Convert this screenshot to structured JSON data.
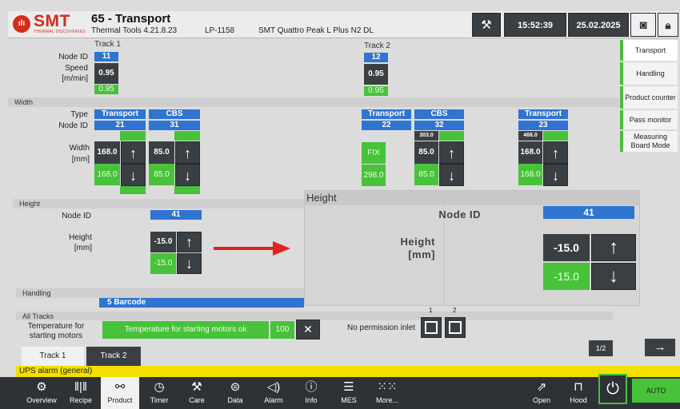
{
  "header": {
    "title": "65 - Transport",
    "version": "Thermal Tools 4.21.8.23",
    "machine_id": "LP-1158",
    "machine_name": "SMT Quattro Peak L Plus N2 DL",
    "time": "15:52:39",
    "date": "25.02.2025",
    "logo": {
      "text": "SMT",
      "subtitle": "THERMAL DISCOVERIES"
    }
  },
  "right_menu": [
    {
      "label": "Transport"
    },
    {
      "label": "Handling"
    },
    {
      "label": "Product counter"
    },
    {
      "label": "Pass monitor"
    },
    {
      "label": "Measuring Board Mode"
    }
  ],
  "tracks_section": {
    "track1_label": "Track 1",
    "track2_label": "Track 2",
    "node_id_label": "Node ID",
    "speed_label": "Speed",
    "speed_unit": "[m/min]",
    "track1": {
      "node_id": "11",
      "speed": "0.95",
      "speed_green": "0.95"
    },
    "track2": {
      "node_id": "12",
      "speed": "0.95",
      "speed_green": "0.95"
    }
  },
  "width_section": {
    "band_label": "Width",
    "type_label": "Type",
    "node_id_label": "Node ID",
    "width_label": "Width",
    "width_unit": "[mm]",
    "columns": [
      {
        "type": "Transport",
        "node_id": "21",
        "value": "168.0",
        "green": "168.0",
        "extra": ""
      },
      {
        "type": "CBS",
        "node_id": "31",
        "value": "85.0",
        "green": "85.0",
        "extra": ""
      },
      {
        "type": "Transport",
        "node_id": "22",
        "value": "FIX",
        "green": "298.0",
        "extra": ""
      },
      {
        "type": "CBS",
        "node_id": "32",
        "value": "85.0",
        "green": "85.0",
        "extra": "303.0"
      },
      {
        "type": "Transport",
        "node_id": "23",
        "value": "168.0",
        "green": "168.0",
        "extra": "466.0"
      }
    ]
  },
  "height_section": {
    "band_label": "Height",
    "node_id_label": "Node ID",
    "height_label": "Height",
    "height_unit": "[mm]",
    "node_id": "41",
    "value": "-15.0",
    "green": "-15.0"
  },
  "zoom": {
    "title": "Height",
    "node_id_label": "Node ID",
    "node_id": "41",
    "height_label": "Height",
    "height_unit": "[mm]",
    "value": "-15.0",
    "green": "-15.0"
  },
  "handling": {
    "band_label": "Handling",
    "value": "5    Barcode"
  },
  "all_tracks": {
    "band_label": "All Tracks",
    "temp_label": "Temperature for starting motors",
    "temp_status": "Temperature for starting motors ok",
    "temp_value": "100",
    "no_permission_label": "No permission inlet",
    "inlet_col1": "1",
    "inlet_col2": "2"
  },
  "tabs": {
    "track1": "Track 1",
    "track2": "Track 2",
    "page": "1/2"
  },
  "alarm": "UPS alarm (general)",
  "nav": [
    {
      "label": "Overview",
      "icon": "gears-icon"
    },
    {
      "label": "Recipe",
      "icon": "barcode-icon"
    },
    {
      "label": "Product",
      "icon": "conveyor-icon"
    },
    {
      "label": "Timer",
      "icon": "clock-icon"
    },
    {
      "label": "Care",
      "icon": "wrench-icon"
    },
    {
      "label": "Data",
      "icon": "data-icon"
    },
    {
      "label": "Alarm",
      "icon": "speaker-icon"
    },
    {
      "label": "Info",
      "icon": "info-icon"
    },
    {
      "label": "MES",
      "icon": "mes-icon"
    },
    {
      "label": "More...",
      "icon": "grid-icon"
    },
    {
      "label": "Open",
      "icon": "open-icon"
    },
    {
      "label": "Hood",
      "icon": "hood-icon"
    }
  ],
  "mode": "AUTO",
  "colors": {
    "accent_green": "#47c23a",
    "field_blue": "#2f74d0",
    "brand_red": "#d52b1e",
    "alarm_yellow": "#f2e000"
  }
}
